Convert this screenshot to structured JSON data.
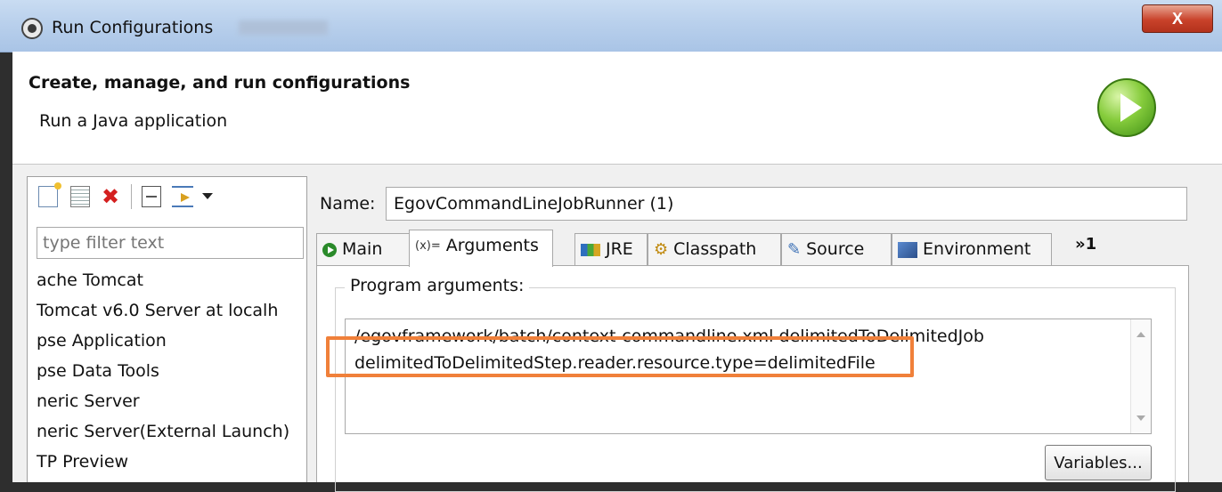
{
  "window": {
    "title": "Run Configurations",
    "close_label": "X"
  },
  "header": {
    "title": "Create, manage, and run configurations",
    "subtitle": "Run a Java application",
    "icon": "run-play-icon"
  },
  "left_pane": {
    "toolbar_icons": [
      "new-config-icon",
      "duplicate-icon",
      "delete-icon",
      "collapse-all-icon",
      "filter-icon",
      "dropdown-arrow-icon"
    ],
    "filter_placeholder": "type filter text",
    "tree_items": [
      "ache Tomcat",
      "Tomcat v6.0 Server at localh",
      "pse Application",
      "pse Data Tools",
      "neric Server",
      "neric Server(External Launch)",
      "TP Preview"
    ]
  },
  "right_pane": {
    "name_label": "Name:",
    "name_value": "EgovCommandLineJobRunner (1)",
    "tabs": [
      {
        "label": "Main",
        "icon": "main-tab-icon"
      },
      {
        "label": "Arguments",
        "icon": "arguments-tab-icon",
        "prefix": "(x)="
      },
      {
        "label": "JRE",
        "icon": "jre-tab-icon"
      },
      {
        "label": "Classpath",
        "icon": "classpath-tab-icon"
      },
      {
        "label": "Source",
        "icon": "source-tab-icon"
      },
      {
        "label": "Environment",
        "icon": "environment-tab-icon"
      }
    ],
    "overflow_label": "»1",
    "program_args_label": "Program arguments:",
    "program_args_lines": [
      "/egovframework/batch/context-commandline.xml delimitedToDelimitedJob",
      "delimitedToDelimitedStep.reader.resource.type=delimitedFile"
    ],
    "variables_label": "Variables..."
  },
  "colors": {
    "highlight": "#f0803a",
    "titlebar": "#b9d0ec",
    "close": "#c9422a"
  }
}
